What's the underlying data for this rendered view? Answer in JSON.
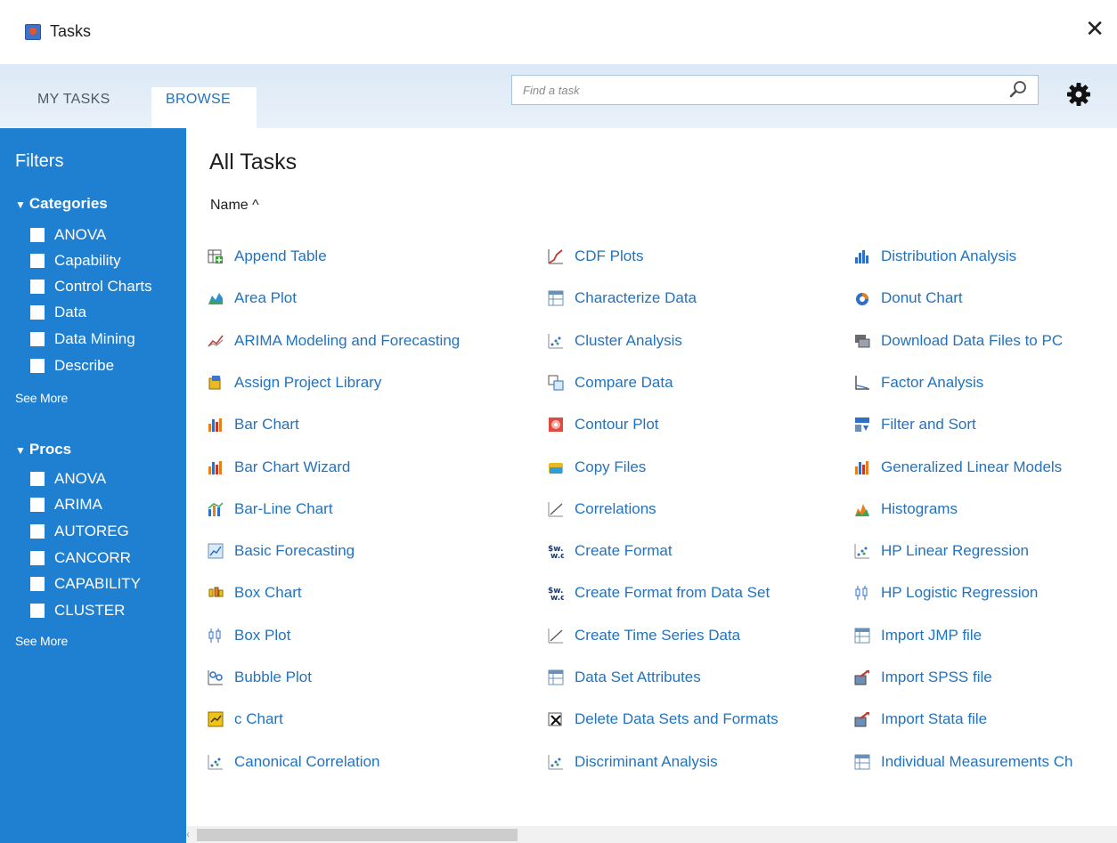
{
  "window": {
    "title": "Tasks",
    "close_symbol": "✕"
  },
  "tabs": [
    {
      "label": "MY TASKS",
      "active": false
    },
    {
      "label": "BROWSE",
      "active": true
    }
  ],
  "search": {
    "placeholder": "Find a task",
    "value": ""
  },
  "filters": {
    "title": "Filters",
    "categories": {
      "label": "Categories",
      "items": [
        "ANOVA",
        "Capability",
        "Control Charts",
        "Data",
        "Data Mining",
        "Describe"
      ],
      "see_more": "See More"
    },
    "procs": {
      "label": "Procs",
      "items": [
        "ANOVA",
        "ARIMA",
        "AUTOREG",
        "CANCORR",
        "CAPABILITY",
        "CLUSTER"
      ],
      "see_more": "See More"
    }
  },
  "main": {
    "title": "All Tasks",
    "sort_label": "Name ^",
    "columns": [
      {
        "tasks": [
          {
            "label": "Append Table",
            "icon": "append-table-icon"
          },
          {
            "label": "Area Plot",
            "icon": "area-plot-icon"
          },
          {
            "label": "ARIMA Modeling and Forecasting",
            "icon": "arima-icon"
          },
          {
            "label": "Assign Project Library",
            "icon": "library-icon"
          },
          {
            "label": "Bar Chart",
            "icon": "bar-chart-icon"
          },
          {
            "label": "Bar Chart Wizard",
            "icon": "bar-chart-icon"
          },
          {
            "label": "Bar-Line Chart",
            "icon": "bar-line-chart-icon"
          },
          {
            "label": "Basic Forecasting",
            "icon": "forecasting-icon"
          },
          {
            "label": "Box Chart",
            "icon": "box-chart-icon"
          },
          {
            "label": "Box Plot",
            "icon": "box-plot-icon"
          },
          {
            "label": "Bubble Plot",
            "icon": "bubble-plot-icon"
          },
          {
            "label": "c Chart",
            "icon": "c-chart-icon"
          },
          {
            "label": "Canonical Correlation",
            "icon": "scatter-icon"
          }
        ]
      },
      {
        "tasks": [
          {
            "label": "CDF Plots",
            "icon": "cdf-plot-icon"
          },
          {
            "label": "Characterize Data",
            "icon": "table-icon"
          },
          {
            "label": "Cluster Analysis",
            "icon": "scatter-icon"
          },
          {
            "label": "Compare Data",
            "icon": "compare-icon"
          },
          {
            "label": "Contour Plot",
            "icon": "contour-plot-icon"
          },
          {
            "label": "Copy Files",
            "icon": "copy-files-icon"
          },
          {
            "label": "Correlations",
            "icon": "line-icon"
          },
          {
            "label": "Create Format",
            "icon": "format-icon"
          },
          {
            "label": "Create Format from Data Set",
            "icon": "format-icon"
          },
          {
            "label": "Create Time Series Data",
            "icon": "line-icon"
          },
          {
            "label": "Data Set Attributes",
            "icon": "table-icon"
          },
          {
            "label": "Delete Data Sets and Formats",
            "icon": "delete-icon"
          },
          {
            "label": "Discriminant Analysis",
            "icon": "scatter-icon"
          }
        ]
      },
      {
        "tasks": [
          {
            "label": "Distribution Analysis",
            "icon": "distribution-icon"
          },
          {
            "label": "Donut Chart",
            "icon": "donut-chart-icon"
          },
          {
            "label": "Download Data Files to PC",
            "icon": "download-icon"
          },
          {
            "label": "Factor Analysis",
            "icon": "axis-icon"
          },
          {
            "label": "Filter and Sort",
            "icon": "filter-icon"
          },
          {
            "label": "Generalized Linear Models",
            "icon": "bar-chart-icon"
          },
          {
            "label": "Histograms",
            "icon": "histogram-icon"
          },
          {
            "label": "HP Linear Regression",
            "icon": "scatter-icon"
          },
          {
            "label": "HP Logistic Regression",
            "icon": "box-plot-icon"
          },
          {
            "label": "Import JMP file",
            "icon": "table-icon"
          },
          {
            "label": "Import SPSS file",
            "icon": "import-icon"
          },
          {
            "label": "Import Stata file",
            "icon": "import-icon"
          },
          {
            "label": "Individual Measurements Ch",
            "icon": "table-icon"
          }
        ]
      }
    ]
  },
  "colors": {
    "accent": "#2273bf",
    "sidebar": "#1f7fd0",
    "header": "#dce9f6"
  }
}
